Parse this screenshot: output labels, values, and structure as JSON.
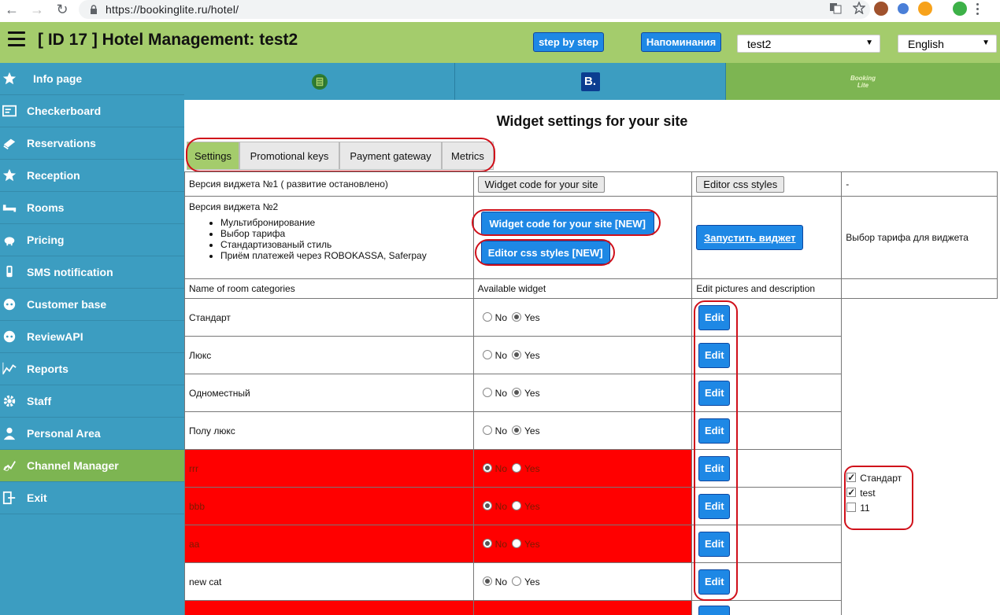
{
  "browser": {
    "url": "https://bookinglite.ru/hotel/"
  },
  "header": {
    "title": "[ ID 17 ] Hotel Management: test2",
    "step_button": "step by step",
    "reminders_button": "Напоминания",
    "hotel_select": "test2",
    "language_select": "English"
  },
  "sidebar": {
    "items": [
      {
        "label": "Info page",
        "icon": "star-icon"
      },
      {
        "label": "Checkerboard",
        "icon": "board-icon"
      },
      {
        "label": "Reservations",
        "icon": "book-icon"
      },
      {
        "label": "Reception",
        "icon": "star-icon"
      },
      {
        "label": "Rooms",
        "icon": "bed-icon"
      },
      {
        "label": "Pricing",
        "icon": "piggy-icon"
      },
      {
        "label": "SMS notification",
        "icon": "phone-icon"
      },
      {
        "label": "Customer base",
        "icon": "user-face-icon"
      },
      {
        "label": "ReviewAPI",
        "icon": "user-face-icon"
      },
      {
        "label": "Reports",
        "icon": "chart-icon"
      },
      {
        "label": "Staff",
        "icon": "gear-icon"
      },
      {
        "label": "Personal Area",
        "icon": "person-icon"
      },
      {
        "label": "Channel Manager",
        "icon": "plug-icon"
      },
      {
        "label": "Exit",
        "icon": "exit-icon"
      }
    ],
    "active_index": 12
  },
  "channel_tabs": {
    "booking_letter": "B.",
    "brand_line1": "Booking",
    "brand_line2": "Lite"
  },
  "content": {
    "title": "Widget settings for your site",
    "tabs": [
      "Settings",
      "Promotional keys",
      "Payment gateway",
      "Metrics"
    ],
    "active_tab": 0,
    "v1": {
      "label": "Версия виджета №1 ( развитие остановлено)",
      "code_button": "Widget code for your site",
      "css_button": "Editor css styles",
      "extra": "-"
    },
    "v2": {
      "label": "Версия виджета №2",
      "features": [
        "Мультибронирование",
        "Выбор тарифа",
        "Стандартизованый стиль",
        "Приём платежей через ROBOKASSA, Saferpay"
      ],
      "code_button": "Widget code for your site [NEW]",
      "css_button": "Editor css styles [NEW]",
      "launch_button": "Запустить виджет",
      "tariff_label": "Выбор тарифа для виджета"
    },
    "columns": [
      "Name of room categories",
      "Available widget",
      "Edit pictures and description"
    ],
    "radio_no": "No",
    "radio_yes": "Yes",
    "edit_label": "Edit",
    "rows": [
      {
        "name": "Стандарт",
        "available": "yes",
        "red": false
      },
      {
        "name": "Люкс",
        "available": "yes",
        "red": false
      },
      {
        "name": "Одноместный",
        "available": "yes",
        "red": false
      },
      {
        "name": "Полу люкс",
        "available": "yes",
        "red": false
      },
      {
        "name": "rrr",
        "available": "no",
        "red": true
      },
      {
        "name": "bbb",
        "available": "no",
        "red": true
      },
      {
        "name": "aa",
        "available": "no",
        "red": true
      },
      {
        "name": "new cat",
        "available": "no",
        "red": false
      }
    ],
    "tariffs": [
      {
        "label": "Стандарт",
        "checked": true
      },
      {
        "label": "test",
        "checked": true
      },
      {
        "label": "11",
        "checked": false
      }
    ]
  }
}
